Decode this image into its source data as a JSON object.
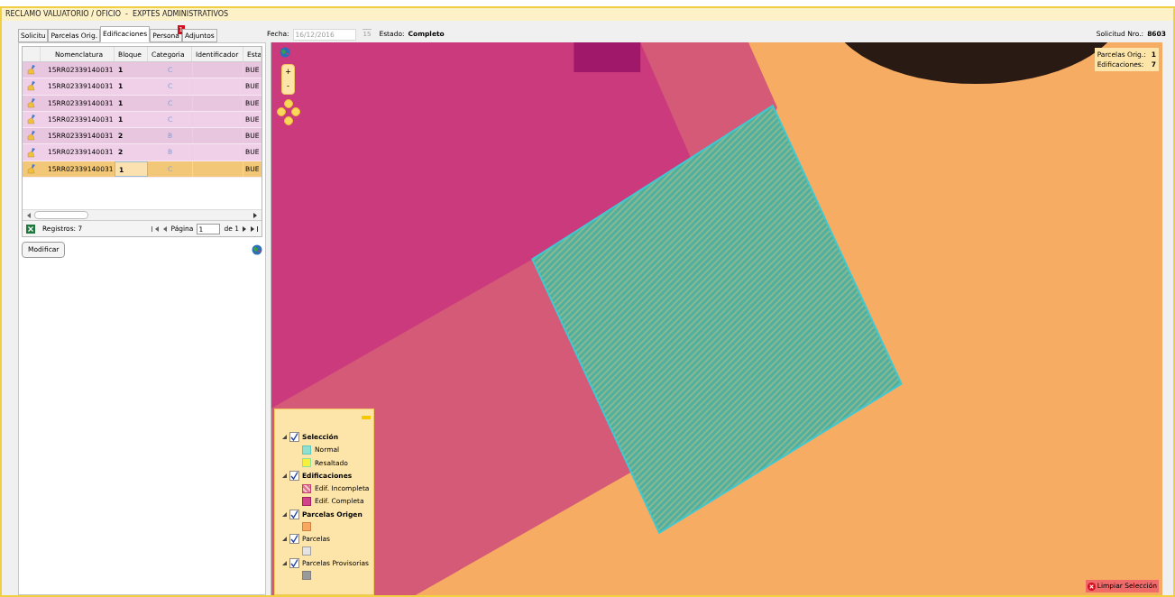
{
  "window": {
    "title": "RECLAMO VALUATORIO / OFICIO  -  EXPTES ADMINISTRATIVOS"
  },
  "tabs": [
    {
      "label": "Solicitu",
      "selected": false
    },
    {
      "label": "Parcelas Orig.",
      "selected": false
    },
    {
      "label": "Edificaciones",
      "selected": true
    },
    {
      "label": "Persona",
      "selected": false,
      "badge": "1"
    },
    {
      "label": "Adjuntos",
      "selected": false
    }
  ],
  "header": {
    "fecha_label": "Fecha:",
    "fecha_value": "16/12/2016",
    "calendar_day": "15",
    "estado_label": "Estado:",
    "estado_value": "Completo",
    "solicitud_label": "Solicitud Nro.:",
    "solicitud_value": "8603"
  },
  "table": {
    "columns": [
      "Nomenclatura",
      "Bloque",
      "Categoria",
      "Identificador",
      "Esta"
    ],
    "rows": [
      {
        "nomenclatura": "15RR02339140031",
        "bloque": "1",
        "categoria": "C",
        "estado": "BUE",
        "selected": false
      },
      {
        "nomenclatura": "15RR02339140031",
        "bloque": "1",
        "categoria": "C",
        "estado": "BUE",
        "selected": false
      },
      {
        "nomenclatura": "15RR02339140031",
        "bloque": "1",
        "categoria": "C",
        "estado": "BUE",
        "selected": false
      },
      {
        "nomenclatura": "15RR02339140031",
        "bloque": "1",
        "categoria": "C",
        "estado": "BUE",
        "selected": false
      },
      {
        "nomenclatura": "15RR02339140031",
        "bloque": "2",
        "categoria": "B",
        "estado": "BUE",
        "selected": false
      },
      {
        "nomenclatura": "15RR02339140031",
        "bloque": "2",
        "categoria": "B",
        "estado": "BUE",
        "selected": false
      },
      {
        "nomenclatura": "15RR02339140031",
        "bloque": "1",
        "categoria": "C",
        "estado": "BUE",
        "selected": true
      }
    ]
  },
  "pager": {
    "records": "Registros: 7",
    "page_label": "Página",
    "page": "1",
    "of": "de 1"
  },
  "modify_button": "Modificar",
  "map": {
    "zoom_in": "+",
    "zoom_out": "-",
    "info": [
      {
        "label": "Parcelas Orig.:",
        "value": "1"
      },
      {
        "label": "Edificaciones:",
        "value": "7"
      }
    ],
    "legend": [
      {
        "label": "Selección",
        "checked": true,
        "bold": true,
        "items": [
          {
            "label": "Normal",
            "kind": "normal"
          },
          {
            "label": "Resaltado",
            "kind": "highlight"
          }
        ]
      },
      {
        "label": "Edificaciones",
        "checked": true,
        "bold": true,
        "items": [
          {
            "label": "Edif. Incompleta",
            "kind": "incomplete"
          },
          {
            "label": "Edif. Completa",
            "kind": "complete"
          }
        ]
      },
      {
        "label": "Parcelas Origen",
        "checked": true,
        "bold": true,
        "items": [
          {
            "kind": "origin"
          }
        ]
      },
      {
        "label": "Parcelas",
        "checked": true,
        "bold": false,
        "items": [
          {
            "kind": "parcel"
          }
        ]
      },
      {
        "label": "Parcelas Provisorias",
        "checked": true,
        "bold": false,
        "items": [
          {
            "kind": "provisional"
          }
        ]
      }
    ],
    "clear_button": "Limpiar Selección"
  }
}
